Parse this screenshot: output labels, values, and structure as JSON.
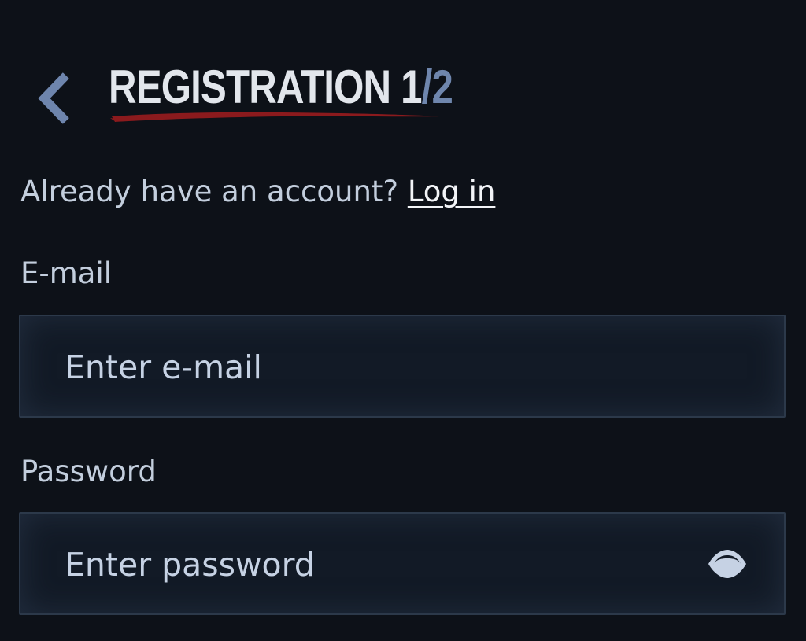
{
  "header": {
    "title": "REGISTRATION",
    "step_current": "1",
    "step_separator": "/",
    "step_total": "2",
    "back_icon": "chevron-left-icon"
  },
  "login_prompt": {
    "text": "Already have an account?",
    "link_label": "Log in"
  },
  "email": {
    "label": "E-mail",
    "placeholder": "Enter e-mail",
    "value": ""
  },
  "password": {
    "label": "Password",
    "placeholder": "Enter password",
    "value": "",
    "toggle_icon": "eye-icon"
  },
  "colors": {
    "background": "#0d1118",
    "accent_underline": "#8b1a1d",
    "step_accent": "#6f86ad",
    "field_border": "#2c394a"
  }
}
